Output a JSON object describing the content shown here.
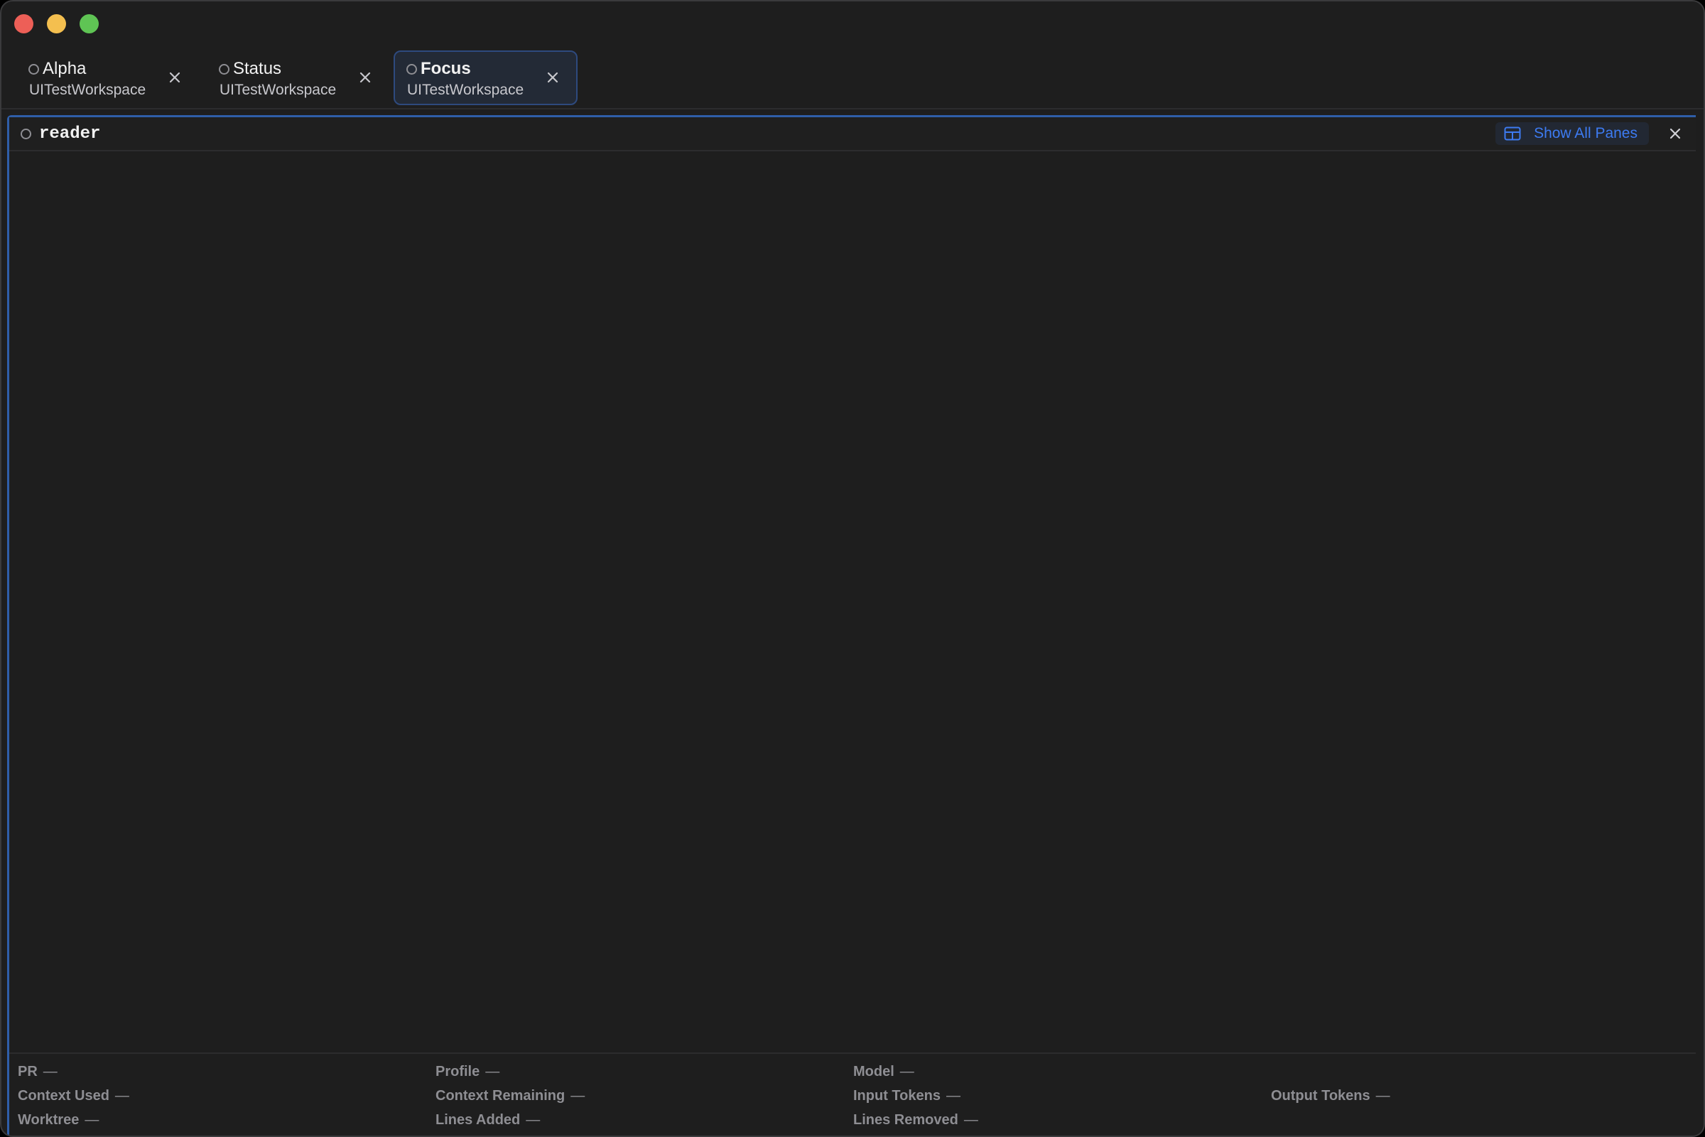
{
  "tabs": [
    {
      "title": "Alpha",
      "subtitle": "UITestWorkspace",
      "active": false
    },
    {
      "title": "Status",
      "subtitle": "UITestWorkspace",
      "active": false
    },
    {
      "title": "Focus",
      "subtitle": "UITestWorkspace",
      "active": true
    }
  ],
  "pane": {
    "title": "reader",
    "show_all_label": "Show All Panes"
  },
  "status": {
    "pr": {
      "label": "PR",
      "value": "—"
    },
    "profile": {
      "label": "Profile",
      "value": "—"
    },
    "model": {
      "label": "Model",
      "value": "—"
    },
    "context_used": {
      "label": "Context Used",
      "value": "—"
    },
    "context_remaining": {
      "label": "Context Remaining",
      "value": "—"
    },
    "input_tokens": {
      "label": "Input Tokens",
      "value": "—"
    },
    "output_tokens": {
      "label": "Output Tokens",
      "value": "—"
    },
    "worktree": {
      "label": "Worktree",
      "value": "—"
    },
    "lines_added": {
      "label": "Lines Added",
      "value": "—"
    },
    "lines_removed": {
      "label": "Lines Removed",
      "value": "—"
    }
  },
  "colors": {
    "accent": "#3d7bf2",
    "focus_border": "#2f5ea8",
    "traffic_close": "#ed5f57",
    "traffic_minimize": "#f4bf4f",
    "traffic_maximize": "#5fc454"
  },
  "icons": {
    "tab_status": "circle-outline-icon",
    "tab_close": "close-icon",
    "show_all_panes": "grid-icon",
    "pane_close": "close-icon"
  }
}
